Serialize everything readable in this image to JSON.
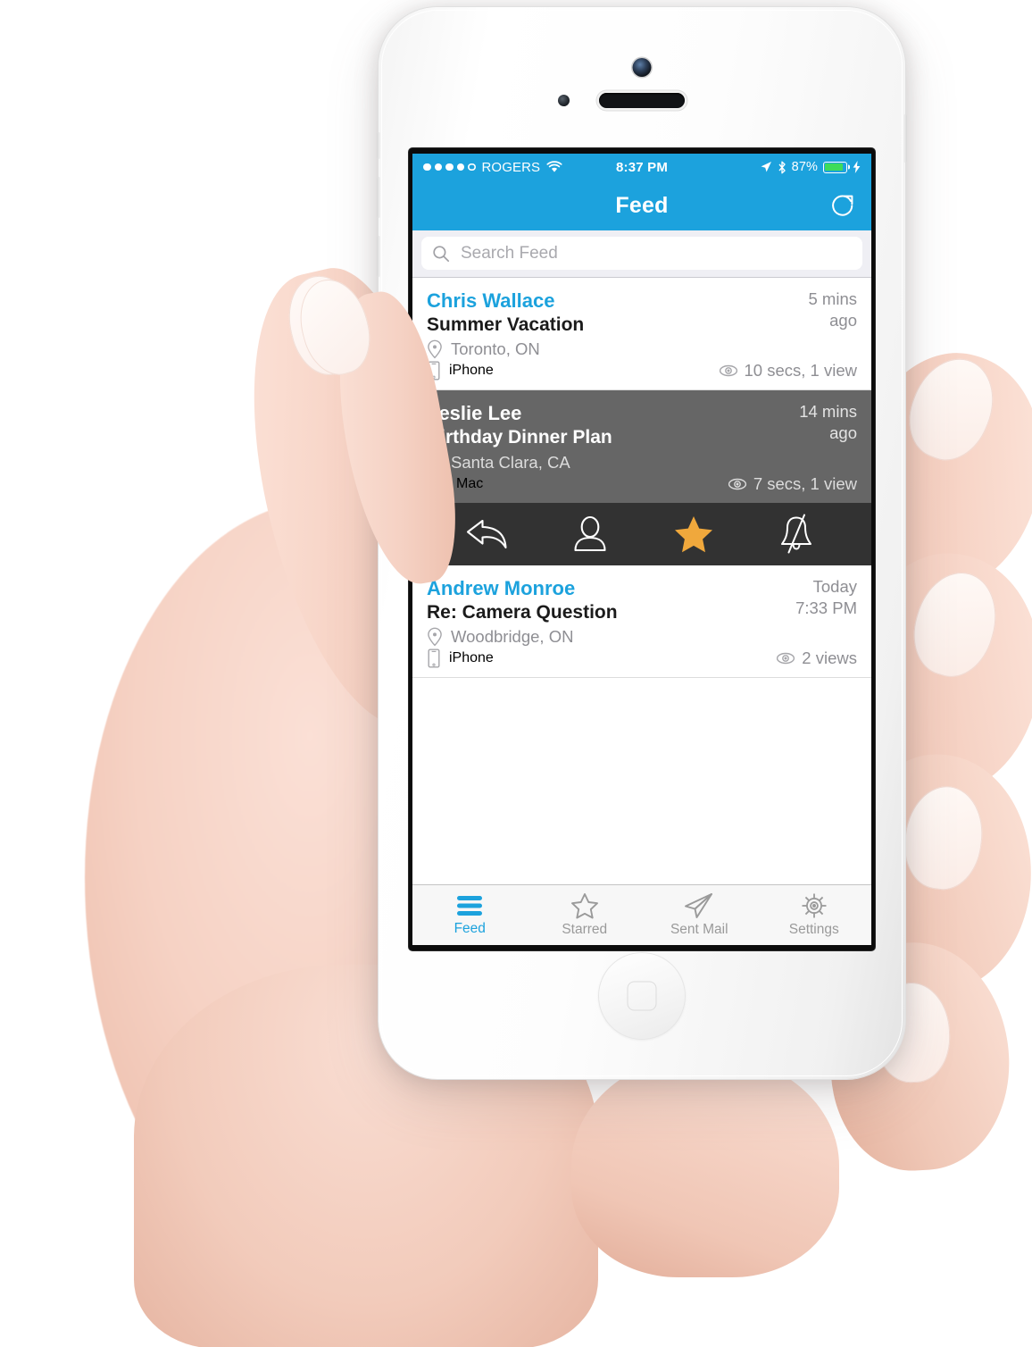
{
  "statusbar": {
    "carrier": "ROGERS",
    "time": "8:37 PM",
    "battery_pct": "87%",
    "signal_dots_filled": 4,
    "signal_dots_total": 5,
    "icons": [
      "wifi-icon",
      "location-arrow-icon",
      "bluetooth-icon",
      "battery-icon",
      "charging-bolt-icon"
    ]
  },
  "navbar": {
    "title": "Feed",
    "refresh_label": "Refresh"
  },
  "search": {
    "placeholder": "Search Feed",
    "value": ""
  },
  "feed": {
    "items": [
      {
        "sender": "Chris Wallace",
        "subject": "Summer Vacation",
        "location": "Toronto, ON",
        "device": "iPhone",
        "device_icon": "phone-icon",
        "time_line1": "5 mins",
        "time_line2": "ago",
        "views": "10 secs, 1 view",
        "selected": false
      },
      {
        "sender": "Leslie Lee",
        "subject": "Birthday Dinner Plan",
        "location": "Santa Clara, CA",
        "device": "Mac",
        "device_icon": "laptop-icon",
        "time_line1": "14 mins",
        "time_line2": "ago",
        "views": "7 secs, 1 view",
        "selected": true
      },
      {
        "sender": "Andrew Monroe",
        "subject": "Re: Camera Question",
        "location": "Woodbridge, ON",
        "device": "iPhone",
        "device_icon": "phone-icon",
        "time_line1": "Today",
        "time_line2": "7:33 PM",
        "views": "2 views",
        "selected": false
      }
    ]
  },
  "actionbar": {
    "buttons": [
      {
        "name": "reply-arrow-icon",
        "label": "Reply",
        "active": false
      },
      {
        "name": "person-icon",
        "label": "Contact",
        "active": false
      },
      {
        "name": "star-icon",
        "label": "Star",
        "active": true
      },
      {
        "name": "bell-slash-icon",
        "label": "Mute",
        "active": false
      }
    ],
    "active_color": "#F0A83C"
  },
  "tabbar": {
    "tabs": [
      {
        "label": "Feed",
        "icon": "lines-icon",
        "active": true
      },
      {
        "label": "Starred",
        "icon": "star-outline-icon",
        "active": false
      },
      {
        "label": "Sent Mail",
        "icon": "paper-plane-icon",
        "active": false
      },
      {
        "label": "Settings",
        "icon": "gear-icon",
        "active": false
      }
    ]
  },
  "colors": {
    "accent_blue": "#1CA2DD",
    "selected_row": "#666666",
    "action_bar": "#323232",
    "star_amber": "#F0A83C",
    "meta_gray": "#8E8E93"
  }
}
